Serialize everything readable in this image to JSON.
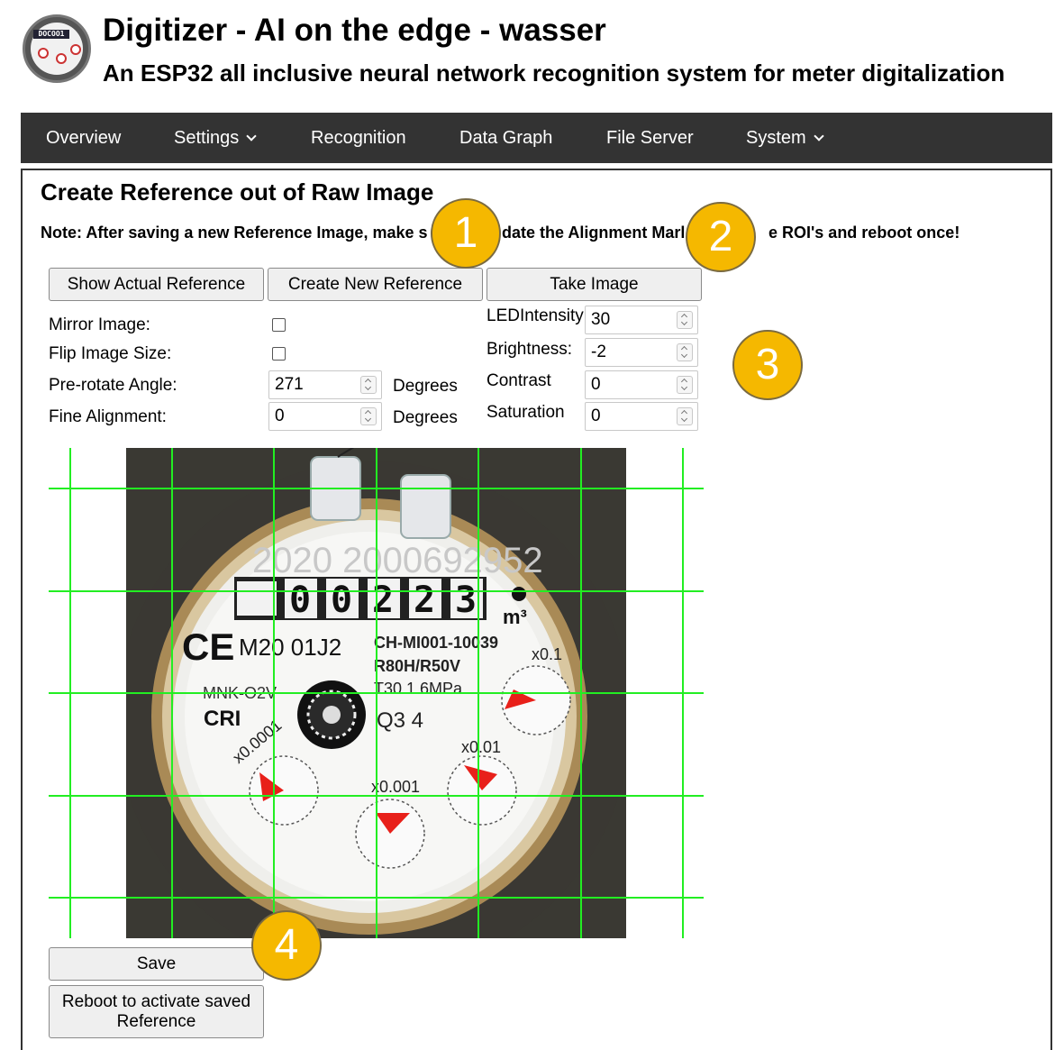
{
  "header": {
    "logo_text": "DOCOO1",
    "title": "Digitizer - AI on the edge - wasser",
    "subtitle": "An ESP32 all inclusive neural network recognition system for meter digitalization"
  },
  "nav": {
    "items": [
      "Overview",
      "Settings",
      "Recognition",
      "Data Graph",
      "File Server",
      "System"
    ]
  },
  "page": {
    "heading": "Create Reference out of Raw Image",
    "note": "Note: After saving a new Reference Image, make s",
    "note_mid": "date the Alignment Marl",
    "note_end": "e ROI's and reboot once!"
  },
  "buttons": {
    "show_ref": "Show Actual Reference",
    "create_ref": "Create New Reference",
    "take_image": "Take Image",
    "save": "Save",
    "reboot_line1": "Reboot to activate saved",
    "reboot_line2": "Reference"
  },
  "form": {
    "mirror_label": "Mirror Image:",
    "flip_label": "Flip Image Size:",
    "prerotate_label": "Pre-rotate Angle:",
    "prerotate_value": "271",
    "fine_label": "Fine Alignment:",
    "fine_value": "0",
    "degrees": "Degrees",
    "led_label": "LEDIntensity:",
    "led_value": "30",
    "brightness_label": "Brightness:",
    "brightness_value": "-2",
    "contrast_label": "Contrast",
    "contrast_value": "0",
    "saturation_label": "Saturation",
    "saturation_value": "0"
  },
  "meter_image": {
    "serial": "2020 2000692952",
    "reading": [
      "0",
      "0",
      "2",
      "2",
      "3"
    ],
    "unit": "m³",
    "ce": "CE",
    "code": "M20 01J2",
    "model": "CH-MI001-10039",
    "ratio": "R80H/R50V",
    "pressure": "T30  1.6MPa",
    "mnk": "MNK-O2V",
    "cri": "CRI",
    "q3": "Q3  4",
    "dial_labels": [
      "x0.0001",
      "x0.001",
      "x0.01",
      "x0.1"
    ]
  },
  "callouts": [
    "1",
    "2",
    "3",
    "4"
  ],
  "colors": {
    "nav_bg": "#333333",
    "grid_line": "#22ee22",
    "callout": "#f5b800",
    "dial_pointer": "#e8201a"
  }
}
